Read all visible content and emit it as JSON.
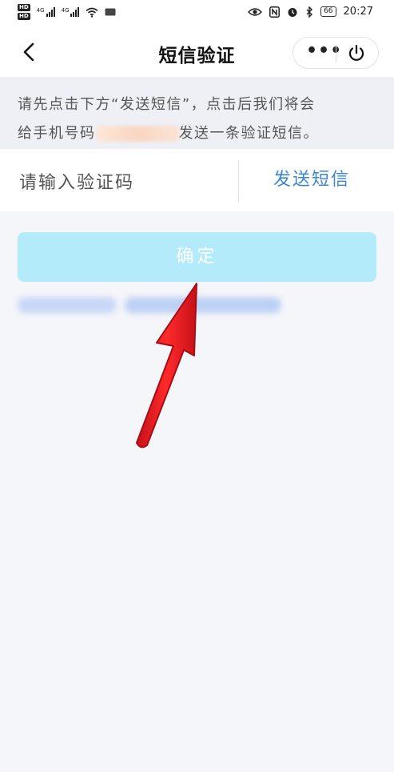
{
  "status_bar": {
    "hd1": "HD",
    "hd2": "HD",
    "net1": "4G",
    "net2": "4G",
    "time": "20:27",
    "battery": "66",
    "icons": [
      "eye-icon",
      "nfc-icon",
      "alarm-icon",
      "bluetooth-icon",
      "battery-icon"
    ]
  },
  "nav": {
    "title": "短信验证",
    "more_label": "•••",
    "icons": [
      "back-icon",
      "power-icon"
    ]
  },
  "hint": {
    "line1": "请先点击下方“发送短信”，点击后我们将会",
    "line2_prefix": "给手机号码",
    "line2_suffix": "发送一条验证短信。"
  },
  "code_input": {
    "placeholder": "请输入验证码",
    "value": ""
  },
  "send_sms_label": "发送短信",
  "confirm_label": "确定",
  "colors": {
    "accent_link": "#3a86d8",
    "confirm_bg": "#b3ebfb",
    "arrow": "#e3181f"
  }
}
